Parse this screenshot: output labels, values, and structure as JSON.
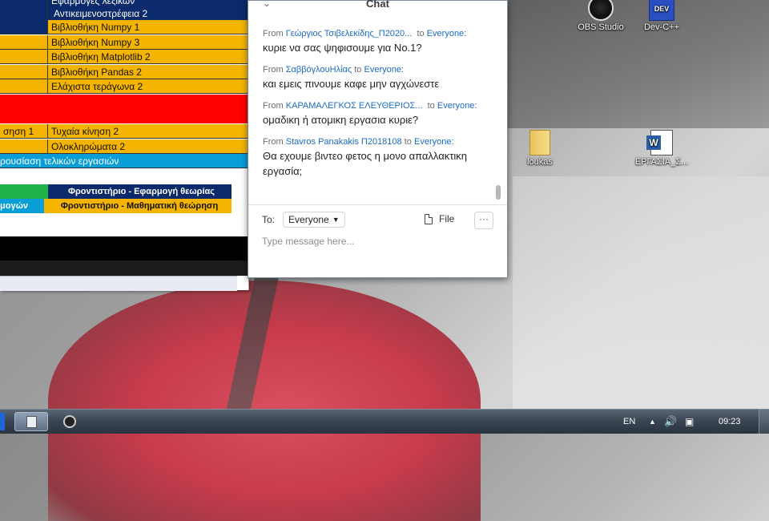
{
  "spreadsheet": {
    "rows": [
      {
        "cells": [
          {
            "text": "",
            "cls": "navy"
          },
          {
            "text": "Εφαρμογές λεξικών",
            "cls": "navy"
          }
        ]
      },
      {
        "cells": [
          {
            "text": "",
            "cls": "navy"
          },
          {
            "text": "Αντικειμενοστρέφεια 2",
            "cls": "navy"
          }
        ]
      },
      {
        "cells": [
          {
            "text": "",
            "cls": "navy"
          },
          {
            "text": "Βιβλιοθήκη Numpy 1",
            "cls": "orange"
          }
        ]
      },
      {
        "cells": [
          {
            "text": "",
            "cls": "orange"
          },
          {
            "text": "Βιβλιοθήκη Numpy 3",
            "cls": "orange"
          }
        ]
      },
      {
        "cells": [
          {
            "text": "",
            "cls": "orange"
          },
          {
            "text": "Βιβλιοθήκη Matplotlib 2",
            "cls": "orange"
          }
        ]
      },
      {
        "cells": [
          {
            "text": "",
            "cls": "orange"
          },
          {
            "text": "Βιβλιοθήκη Pandas 2",
            "cls": "orange"
          }
        ]
      },
      {
        "cells": [
          {
            "text": "",
            "cls": "orange"
          },
          {
            "text": "Ελάχιστα τεράγωνα 2",
            "cls": "orange"
          }
        ]
      },
      {
        "cells": [
          {
            "text": "σηση 1",
            "cls": "orange"
          },
          {
            "text": "Τυχαία κίνηση 2",
            "cls": "orange"
          }
        ]
      },
      {
        "cells": [
          {
            "text": "",
            "cls": "orange"
          },
          {
            "text": "Ολοκληρώματα 2",
            "cls": "orange"
          }
        ]
      },
      {
        "cells": [
          {
            "text": "ρουσίαση τελικών εργασιών",
            "cls": "cyan"
          }
        ]
      }
    ],
    "legend": [
      {
        "text": "Φροντιστήριο - Εφαρμογή θεωρίας",
        "cls": "navy"
      },
      {
        "text": "Φροντιστήριο - Μαθηματική θεώρηση",
        "cls": "orange"
      }
    ],
    "legend_left_fragment": "μογών"
  },
  "chat": {
    "title": "Chat",
    "chevron_icon": "chevron-down-icon",
    "from_label": "From",
    "to_label_inline": "to",
    "messages": [
      {
        "from": "Γεώργιος Τσιβελεκίδης_Π2020...",
        "to": "Everyone:",
        "text": "κυριε να σας ψηφισουμε για Νο.1?"
      },
      {
        "from": "ΣαββόγλουΗλίας",
        "to": "Everyone:",
        "text": "και εμεις πινουμε καφε μην αγχώνεστε"
      },
      {
        "from": "ΚΑΡΑΜΑΛΕΓΚΟΣ ΕΛΕΥΘΕΡΙΟΣ...",
        "to": "Everyone:",
        "text": "ομαδικη ή ατομικη εργασια κυριε?"
      },
      {
        "from": "Stavros Panakakis Π2018108",
        "to": "Everyone:",
        "text": "Θα εχουμε βιντεο φετος η μονο απαλλακτικη εργασία;"
      }
    ],
    "to_label": "To:",
    "recipient": "Everyone",
    "file_label": "File",
    "more_label": "···",
    "input_placeholder": "Type message here..."
  },
  "desktop_icons": [
    {
      "label": "OBS Studio",
      "icon": "obs-studio-icon"
    },
    {
      "label": "Dev-C++",
      "icon": "dev-cpp-icon"
    },
    {
      "label": "loukas",
      "icon": "folder-icon"
    },
    {
      "label": "ΕΡΓΑΣΙΑ_Σ...",
      "icon": "word-document-icon"
    }
  ],
  "taskbar": {
    "language": "EN",
    "clock": "09:23"
  },
  "colors": {
    "accent_blue": "#1b6ac9",
    "sheet_navy": "#0b2a6b",
    "sheet_orange": "#f4b400",
    "sheet_red": "#ff0000",
    "sheet_cyan": "#0a9ed8"
  }
}
